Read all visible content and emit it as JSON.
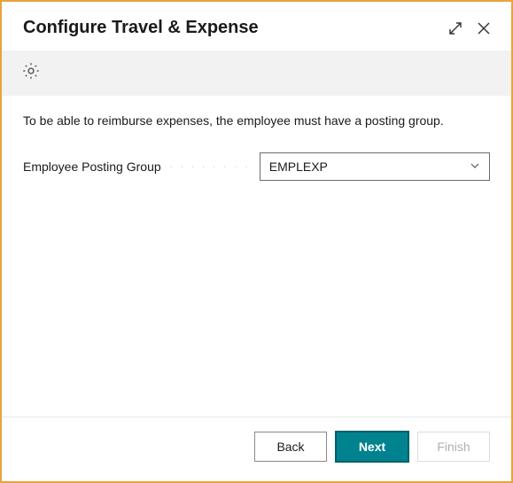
{
  "header": {
    "title": "Configure Travel & Expense"
  },
  "banner": {
    "icon": "gear-icon"
  },
  "content": {
    "description": "To be able to reimburse expenses, the employee must have a posting group.",
    "field_label": "Employee Posting Group",
    "field_value": "EMPLEXP"
  },
  "footer": {
    "back": "Back",
    "next": "Next",
    "finish": "Finish"
  }
}
